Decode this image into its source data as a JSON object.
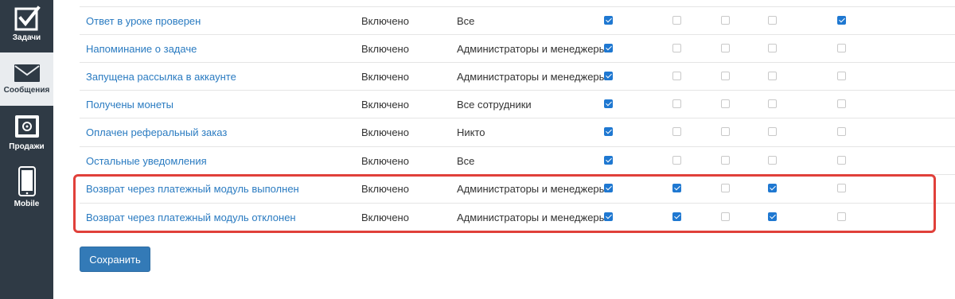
{
  "sidebar": {
    "items": [
      {
        "label": "Задачи",
        "icon": "checkbox-icon"
      },
      {
        "label": "Сообщения",
        "icon": "envelope-icon"
      },
      {
        "label": "Продажи",
        "icon": "safe-icon"
      },
      {
        "label": "Mobile",
        "icon": "phone-icon"
      }
    ]
  },
  "table": {
    "rows": [
      {
        "name": "Ответ в уроке проверен",
        "status": "Включено",
        "recipients": "Все",
        "checks": [
          true,
          false,
          false,
          false,
          true
        ]
      },
      {
        "name": "Напоминание о задаче",
        "status": "Включено",
        "recipients": "Администраторы и менеджеры",
        "checks": [
          true,
          false,
          false,
          false,
          false
        ]
      },
      {
        "name": "Запущена рассылка в аккаунте",
        "status": "Включено",
        "recipients": "Администраторы и менеджеры",
        "checks": [
          true,
          false,
          false,
          false,
          false
        ]
      },
      {
        "name": "Получены монеты",
        "status": "Включено",
        "recipients": "Все сотрудники",
        "checks": [
          true,
          false,
          false,
          false,
          false
        ]
      },
      {
        "name": "Оплачен реферальный заказ",
        "status": "Включено",
        "recipients": "Никто",
        "checks": [
          true,
          false,
          false,
          false,
          false
        ]
      },
      {
        "name": "Остальные уведомления",
        "status": "Включено",
        "recipients": "Все",
        "checks": [
          true,
          false,
          false,
          false,
          false
        ]
      },
      {
        "name": "Возврат через платежный модуль выполнен",
        "status": "Включено",
        "recipients": "Администраторы и менеджеры",
        "checks": [
          true,
          true,
          false,
          true,
          false
        ]
      },
      {
        "name": "Возврат через платежный модуль отклонен",
        "status": "Включено",
        "recipients": "Администраторы и менеджеры",
        "checks": [
          true,
          true,
          false,
          true,
          false
        ]
      }
    ]
  },
  "actions": {
    "save_label": "Сохранить"
  },
  "colors": {
    "accent": "#337ab7",
    "link": "#2a7bc1",
    "checkbox_on": "#1f78d1",
    "highlight": "#e0403a",
    "sidebar": "#2f3a45"
  }
}
